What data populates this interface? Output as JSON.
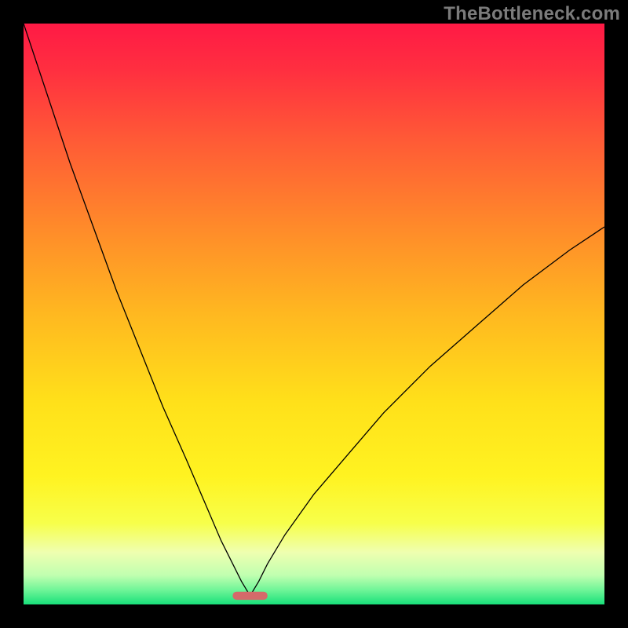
{
  "watermark": "TheBottleneck.com",
  "chart_data": {
    "type": "line",
    "title": "",
    "xlabel": "",
    "ylabel": "",
    "xlim": [
      0,
      100
    ],
    "ylim": [
      0,
      100
    ],
    "grid": false,
    "legend": false,
    "axes_hidden": true,
    "background_gradient_stops": [
      {
        "offset": 0.0,
        "color": "#ff1a45"
      },
      {
        "offset": 0.08,
        "color": "#ff2f40"
      },
      {
        "offset": 0.2,
        "color": "#ff5a36"
      },
      {
        "offset": 0.35,
        "color": "#ff8a2a"
      },
      {
        "offset": 0.5,
        "color": "#ffb820"
      },
      {
        "offset": 0.65,
        "color": "#ffe01a"
      },
      {
        "offset": 0.78,
        "color": "#fff321"
      },
      {
        "offset": 0.86,
        "color": "#f7ff4a"
      },
      {
        "offset": 0.91,
        "color": "#efffb0"
      },
      {
        "offset": 0.95,
        "color": "#c0ffb0"
      },
      {
        "offset": 0.975,
        "color": "#70f598"
      },
      {
        "offset": 1.0,
        "color": "#18e07a"
      }
    ],
    "curve_minimum_x": 39,
    "marker": {
      "x": 39,
      "y": 1.5,
      "width": 6,
      "height": 1.4,
      "color": "#d46a6a"
    },
    "series": [
      {
        "name": "curve",
        "stroke": "#000000",
        "stroke_width": 1.3,
        "x": [
          0,
          4,
          8,
          12,
          16,
          20,
          24,
          28,
          31,
          34,
          36,
          37.5,
          39,
          40.5,
          42,
          45,
          50,
          56,
          62,
          70,
          78,
          86,
          94,
          100
        ],
        "values": [
          100,
          88,
          76,
          65,
          54,
          44,
          34,
          25,
          18,
          11,
          7,
          4,
          1.5,
          4,
          7,
          12,
          19,
          26,
          33,
          41,
          48,
          55,
          61,
          65
        ]
      }
    ]
  }
}
